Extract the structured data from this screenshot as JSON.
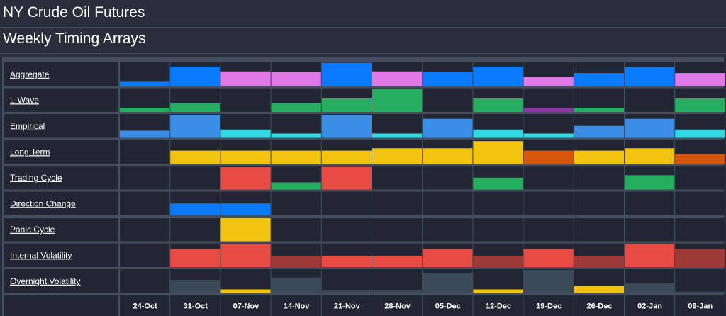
{
  "page": {
    "title": "NY Crude Oil Futures",
    "subtitle": "Weekly Timing Arrays"
  },
  "chart_data": {
    "type": "heatmap",
    "title": "Weekly Timing Arrays",
    "categories": [
      "24-Oct",
      "31-Oct",
      "07-Nov",
      "14-Nov",
      "21-Nov",
      "28-Nov",
      "05-Dec",
      "12-Dec",
      "19-Dec",
      "26-Dec",
      "02-Jan",
      "09-Jan"
    ],
    "value_scale": [
      0,
      1
    ],
    "rows": [
      {
        "name": "Aggregate",
        "values": [
          0.18,
          0.82,
          0.62,
          0.6,
          0.98,
          0.62,
          0.6,
          0.82,
          0.4,
          0.55,
          0.8,
          0.55
        ],
        "colors": [
          "#0a7bff",
          "#0a7bff",
          "#e079e6",
          "#e079e6",
          "#0a7bff",
          "#e079e6",
          "#0a7bff",
          "#0a7bff",
          "#e079e6",
          "#0a7bff",
          "#0a7bff",
          "#e079e6"
        ]
      },
      {
        "name": "L-Wave",
        "values": [
          0.18,
          0.36,
          0,
          0.36,
          0.57,
          0.97,
          0,
          0.57,
          0.18,
          0.18,
          0,
          0.57
        ],
        "colors": [
          "#25ad60",
          "#25ad60",
          "#25ad60",
          "#25ad60",
          "#25ad60",
          "#25ad60",
          "#25ad60",
          "#25ad60",
          "#8a3aa6",
          "#25ad60",
          "#25ad60",
          "#25ad60"
        ]
      },
      {
        "name": "Empirical",
        "values": [
          0.3,
          0.97,
          0.35,
          0.18,
          0.97,
          0.18,
          0.8,
          0.35,
          0.18,
          0.5,
          0.8,
          0.35
        ],
        "colors": [
          "#3a8ee6",
          "#3a8ee6",
          "#32d9e0",
          "#32d9e0",
          "#3a8ee6",
          "#32d9e0",
          "#3a8ee6",
          "#32d9e0",
          "#32d9e0",
          "#3a8ee6",
          "#3a8ee6",
          "#32d9e0"
        ]
      },
      {
        "name": "Long Term",
        "values": [
          0,
          0.55,
          0.55,
          0.55,
          0.55,
          0.65,
          0.65,
          0.95,
          0.55,
          0.55,
          0.65,
          0.4
        ],
        "colors": [
          "#f2c40f",
          "#f2c40f",
          "#f2c40f",
          "#f2c40f",
          "#f2c40f",
          "#f2c40f",
          "#f2c40f",
          "#f2c40f",
          "#d8560a",
          "#f2c40f",
          "#f2c40f",
          "#d8560a"
        ]
      },
      {
        "name": "Trading Cycle",
        "values": [
          0,
          0,
          0.95,
          0.3,
          0.98,
          0,
          0,
          0.5,
          0,
          0,
          0.6,
          0
        ],
        "colors": [
          "#e84b43",
          "#e84b43",
          "#e84b43",
          "#25ad60",
          "#e84b43",
          "#e84b43",
          "#e84b43",
          "#25ad60",
          "#e84b43",
          "#e84b43",
          "#25ad60",
          "#e84b43"
        ]
      },
      {
        "name": "Direction Change",
        "values": [
          0,
          0.5,
          0.5,
          0,
          0,
          0,
          0,
          0,
          0,
          0,
          0,
          0
        ],
        "colors": [
          "#0a7bff",
          "#0a7bff",
          "#0a7bff",
          "#0a7bff",
          "#0a7bff",
          "#0a7bff",
          "#0a7bff",
          "#0a7bff",
          "#0a7bff",
          "#0a7bff",
          "#0a7bff",
          "#0a7bff"
        ]
      },
      {
        "name": "Panic Cycle",
        "values": [
          0,
          0,
          0.97,
          0,
          0,
          0,
          0,
          0,
          0,
          0,
          0,
          0
        ],
        "colors": [
          "#f2c40f",
          "#f2c40f",
          "#f2c40f",
          "#f2c40f",
          "#f2c40f",
          "#f2c40f",
          "#f2c40f",
          "#f2c40f",
          "#f2c40f",
          "#f2c40f",
          "#f2c40f",
          "#f2c40f"
        ]
      },
      {
        "name": "Internal Volatility",
        "values": [
          0,
          0.75,
          0.97,
          0.48,
          0.48,
          0.48,
          0.75,
          0.48,
          0.75,
          0.48,
          0.97,
          0.75
        ],
        "colors": [
          "#e84b43",
          "#e84b43",
          "#e84b43",
          "#9e3a36",
          "#e84b43",
          "#e84b43",
          "#e84b43",
          "#9e3a36",
          "#e84b43",
          "#9e3a36",
          "#e84b43",
          "#9e3a36"
        ]
      },
      {
        "name": "Overnight Volatility",
        "values": [
          0,
          0.55,
          0.15,
          0.65,
          0.12,
          0.12,
          0.85,
          0.15,
          0.97,
          0.3,
          0.4,
          0.05
        ],
        "colors": [
          "#3a4a58",
          "#3a4a58",
          "#f2c40f",
          "#3a4a58",
          "#3a4a58",
          "#3a4a58",
          "#3a4a58",
          "#f2c40f",
          "#3a4a58",
          "#f2c40f",
          "#3a4a58",
          "#3a4a58"
        ]
      }
    ]
  }
}
